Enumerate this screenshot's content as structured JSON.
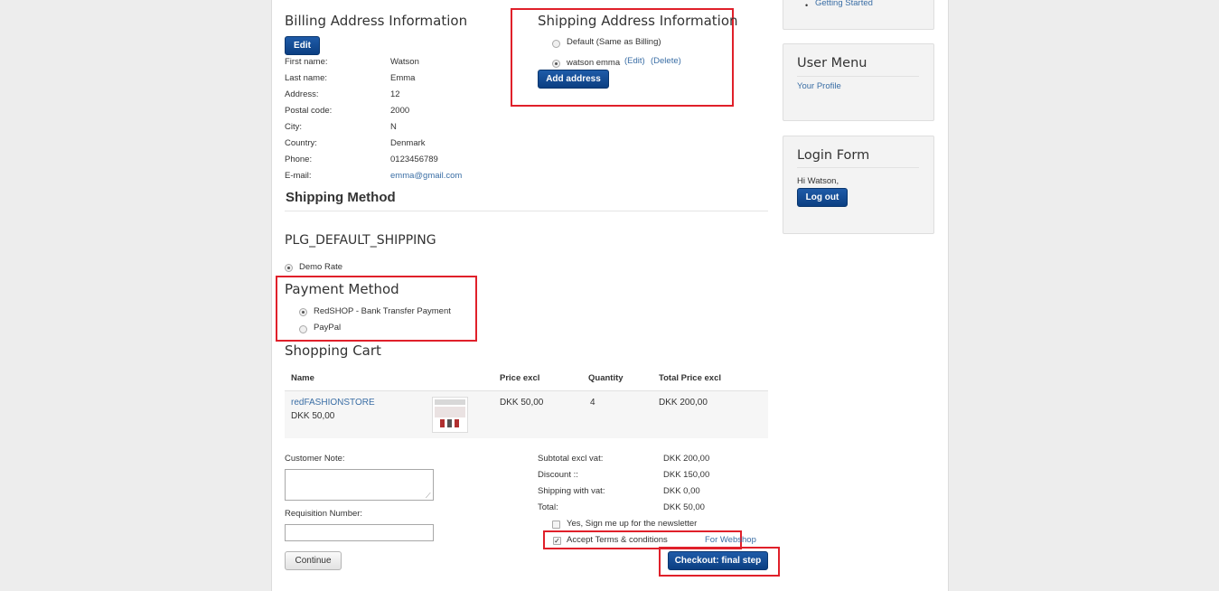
{
  "sidebar_top": {
    "link": "Getting Started"
  },
  "user_menu": {
    "title": "User Menu",
    "items": [
      "Your Profile"
    ]
  },
  "login_form": {
    "title": "Login Form",
    "greeting": "Hi Watson,",
    "logout_label": "Log out"
  },
  "billing": {
    "title": "Billing Address Information",
    "edit_label": "Edit",
    "fields": [
      {
        "label": "First name:",
        "value": "Watson"
      },
      {
        "label": "Last name:",
        "value": "Emma"
      },
      {
        "label": "Address:",
        "value": "12"
      },
      {
        "label": "Postal code:",
        "value": "2000"
      },
      {
        "label": "City:",
        "value": "N"
      },
      {
        "label": "Country:",
        "value": "Denmark"
      },
      {
        "label": "Phone:",
        "value": "0123456789"
      },
      {
        "label": "E-mail:",
        "value": "emma@gmail.com"
      }
    ]
  },
  "shipping_address": {
    "title": "Shipping Address Information",
    "option_default": "Default (Same as Billing)",
    "option_saved_name": "watson emma",
    "edit_link": "(Edit)",
    "delete_link": "(Delete)",
    "add_label": "Add address"
  },
  "shipping_method": {
    "title": "Shipping Method",
    "plugin_title": "PLG_DEFAULT_SHIPPING",
    "rate_label": "Demo Rate"
  },
  "payment_method": {
    "title": "Payment Method",
    "options": [
      "RedSHOP - Bank Transfer Payment",
      "PayPal"
    ]
  },
  "cart": {
    "title": "Shopping Cart",
    "columns": [
      "Name",
      "Price excl",
      "Quantity",
      "Total Price excl"
    ],
    "rows": [
      {
        "name": "redFASHIONSTORE",
        "unit_price": "DKK 50,00",
        "price": "DKK 50,00",
        "quantity": "4",
        "total": "DKK 200,00"
      }
    ]
  },
  "note": {
    "customer_note_label": "Customer Note:",
    "requisition_label": "Requisition Number:",
    "continue_label": "Continue"
  },
  "totals": [
    {
      "label": "Subtotal excl vat:",
      "value": "DKK 200,00"
    },
    {
      "label": "Discount ::",
      "value": "DKK 150,00"
    },
    {
      "label": "Shipping with vat:",
      "value": "DKK 0,00"
    },
    {
      "label": "Total:",
      "value": "DKK 50,00"
    }
  ],
  "newsletter_label": "Yes, Sign me up for the newsletter",
  "terms": {
    "label": "Accept Terms & conditions",
    "link": "For Webshop"
  },
  "checkout_label": "Checkout: final step",
  "colors": {
    "button_blue": "#0b3f82",
    "highlight_red": "#e0202a",
    "link_blue": "#3a6ea5"
  }
}
